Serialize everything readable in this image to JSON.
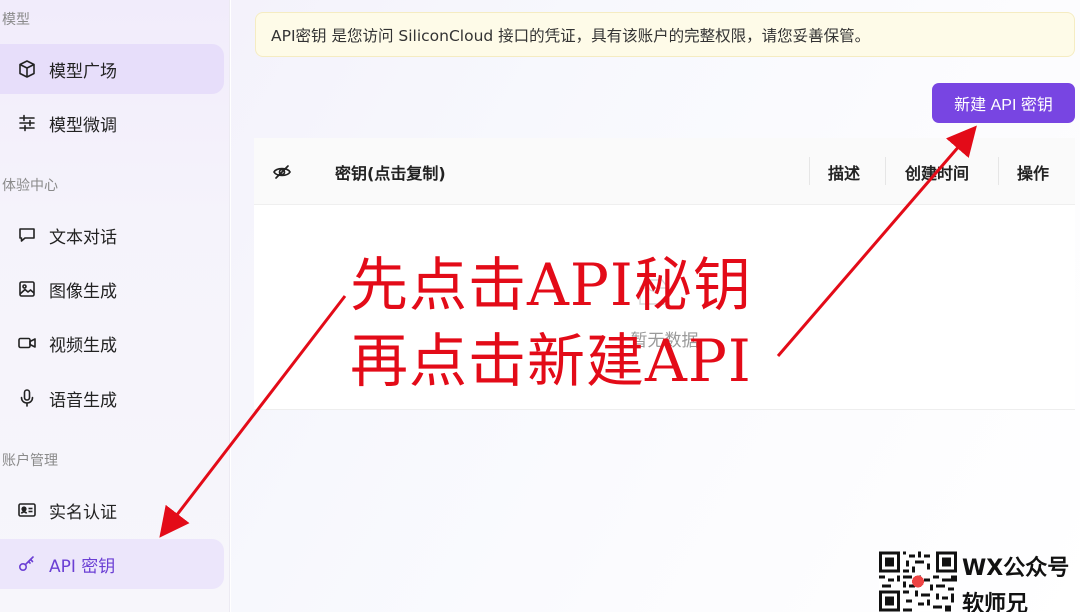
{
  "sidebar": {
    "sections": [
      {
        "label": "模型"
      },
      {
        "label": "体验中心"
      },
      {
        "label": "账户管理"
      }
    ],
    "items": [
      {
        "label": "模型广场",
        "icon": "cube-icon"
      },
      {
        "label": "模型微调",
        "icon": "sliders-icon"
      },
      {
        "label": "文本对话",
        "icon": "chat-bubble-icon"
      },
      {
        "label": "图像生成",
        "icon": "image-icon"
      },
      {
        "label": "视频生成",
        "icon": "video-camera-icon"
      },
      {
        "label": "语音生成",
        "icon": "microphone-icon"
      },
      {
        "label": "实名认证",
        "icon": "id-card-icon"
      },
      {
        "label": "API 密钥",
        "icon": "key-icon"
      }
    ]
  },
  "main": {
    "notice": "API密钥 是您访问 SiliconCloud 接口的凭证，具有该账户的完整权限，请您妥善保管。",
    "new_key_button": "新建 API 密钥",
    "table": {
      "columns": [
        "密钥(点击复制)",
        "描述",
        "创建时间",
        "操作"
      ],
      "empty_text": "暂无数据"
    }
  },
  "annotation": {
    "line1": "先点击API秘钥",
    "line2": "再点击新建API",
    "color": "#e30b18"
  },
  "watermark": {
    "line1": "WX公众号",
    "line2": "软师兄"
  },
  "colors": {
    "accent": "#7845e2",
    "active_text": "#6b3fd4",
    "notice_bg": "#fefbe8"
  }
}
